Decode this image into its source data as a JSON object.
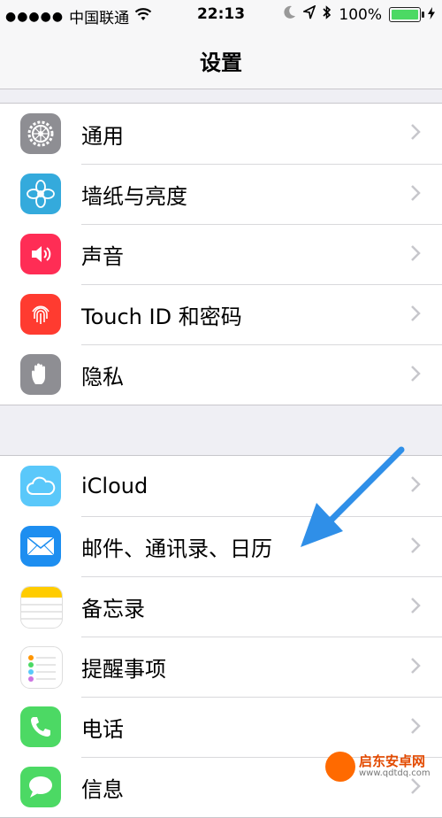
{
  "status_bar": {
    "carrier": "中国联通",
    "time": "22:13",
    "battery_percent": "100%",
    "signal_dots": "●●●●●"
  },
  "nav": {
    "title": "设置"
  },
  "groups": [
    {
      "items": [
        {
          "label": "通用",
          "icon": "gear-icon",
          "icon_color": "#8e8e93"
        },
        {
          "label": "墙纸与亮度",
          "icon": "flower-icon",
          "icon_color": "#34aadc"
        },
        {
          "label": "声音",
          "icon": "speaker-icon",
          "icon_color": "#ff2d55"
        },
        {
          "label": "Touch ID 和密码",
          "icon": "fingerprint-icon",
          "icon_color": "#ff3b30"
        },
        {
          "label": "隐私",
          "icon": "hand-icon",
          "icon_color": "#8e8e93"
        }
      ]
    },
    {
      "items": [
        {
          "label": "iCloud",
          "icon": "cloud-icon",
          "icon_color": "#5ac8fa"
        },
        {
          "label": "邮件、通讯录、日历",
          "icon": "mail-icon",
          "icon_color": "#1d8ef0"
        },
        {
          "label": "备忘录",
          "icon": "notes-icon",
          "icon_color": "#ffcc00"
        },
        {
          "label": "提醒事项",
          "icon": "reminders-icon",
          "icon_color": "#ffffff"
        },
        {
          "label": "电话",
          "icon": "phone-icon",
          "icon_color": "#4cd964"
        },
        {
          "label": "信息",
          "icon": "messages-icon",
          "icon_color": "#4cd964"
        }
      ]
    }
  ],
  "watermark": {
    "name": "启东安卓网",
    "url": "www.qdtdq.com"
  },
  "colors": {
    "accent": "#1d8ef0",
    "background": "#efeff4",
    "battery": "#4cd964",
    "arrow": "#2f8fe8"
  }
}
